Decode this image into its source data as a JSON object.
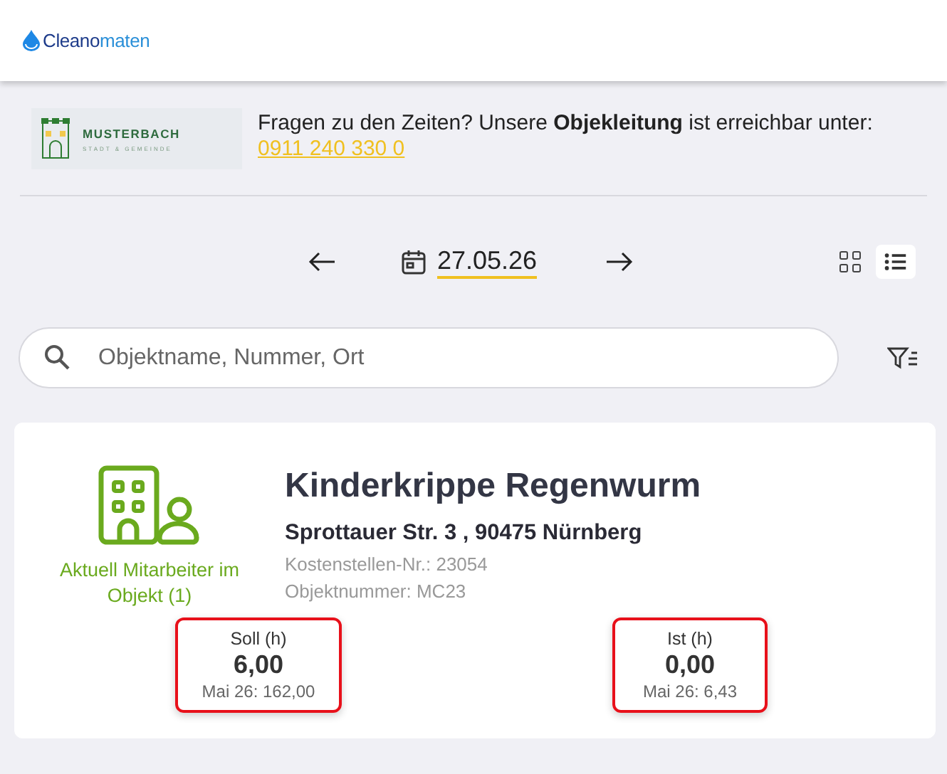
{
  "header": {
    "logo": {
      "part_1": "Cleano",
      "part_2": "maten"
    }
  },
  "client": {
    "name": "MUSTERBACH",
    "subtitle": "STADT & GEMEINDE",
    "message": "Fragen zu den Zeiten? Unsere **Objekleitung** ist erreichbar unter:",
    "phone": "0911 240 330 0"
  },
  "date_nav": {
    "date": "27.05.26",
    "views": [
      {
        "kind": "grid",
        "selected": false
      },
      {
        "kind": "list",
        "selected": true
      }
    ]
  },
  "search": {
    "placeholder": "Objektname, Nummer, Ort"
  },
  "objects": [
    {
      "name": "Kinderkrippe Regenwurm",
      "address": "Sprottauer Str. 3 , 90475 Nürnberg",
      "cost_center": "Kostenstellen-Nr.: 23054",
      "object_number": "Objektnummer: MC23",
      "presence": "Aktuell Mitarbeiter im Objekt (1)",
      "stats": [
        {
          "label": "Soll (h)",
          "value": "6,00",
          "month": "Mai 26: 162,00"
        },
        {
          "label": "Ist (h)",
          "value": "0,00",
          "month": "Mai 26: 6,43"
        }
      ]
    }
  ]
}
